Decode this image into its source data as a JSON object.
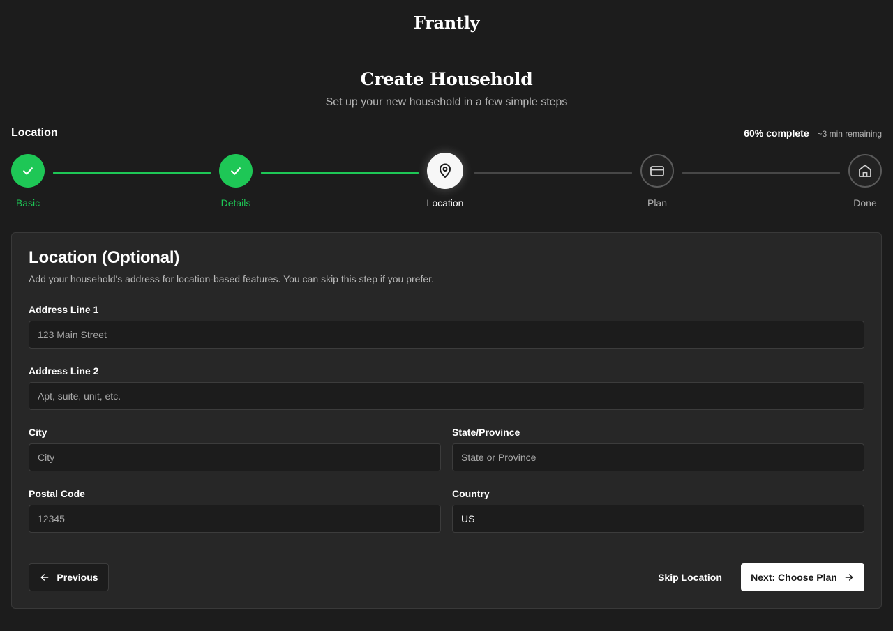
{
  "app": {
    "brand": "Frantly"
  },
  "header": {
    "title": "Create Household",
    "subtitle": "Set up your new household in a few simple steps"
  },
  "progress": {
    "current_step_name": "Location",
    "percent_label": "60% complete",
    "percent_value": 60,
    "remaining_label": "~3 min remaining"
  },
  "steps": [
    {
      "label": "Basic",
      "state": "done",
      "icon": "check-icon"
    },
    {
      "label": "Details",
      "state": "done",
      "icon": "check-icon"
    },
    {
      "label": "Location",
      "state": "current",
      "icon": "map-pin-icon"
    },
    {
      "label": "Plan",
      "state": "pending",
      "icon": "credit-card-icon"
    },
    {
      "label": "Done",
      "state": "pending",
      "icon": "home-icon"
    }
  ],
  "form": {
    "title": "Location (Optional)",
    "description": "Add your household's address for location-based features. You can skip this step if you prefer.",
    "address1": {
      "label": "Address Line 1",
      "placeholder": "123 Main Street",
      "value": ""
    },
    "address2": {
      "label": "Address Line 2",
      "placeholder": "Apt, suite, unit, etc.",
      "value": ""
    },
    "city": {
      "label": "City",
      "placeholder": "City",
      "value": ""
    },
    "state": {
      "label": "State/Province",
      "placeholder": "State or Province",
      "value": ""
    },
    "postal": {
      "label": "Postal Code",
      "placeholder": "12345",
      "value": ""
    },
    "country": {
      "label": "Country",
      "placeholder": "",
      "value": "US"
    }
  },
  "actions": {
    "previous_label": "Previous",
    "skip_label": "Skip Location",
    "next_label": "Next: Choose Plan"
  },
  "colors": {
    "accent_green": "#1ec756",
    "background": "#1c1c1c",
    "card": "#272727"
  }
}
